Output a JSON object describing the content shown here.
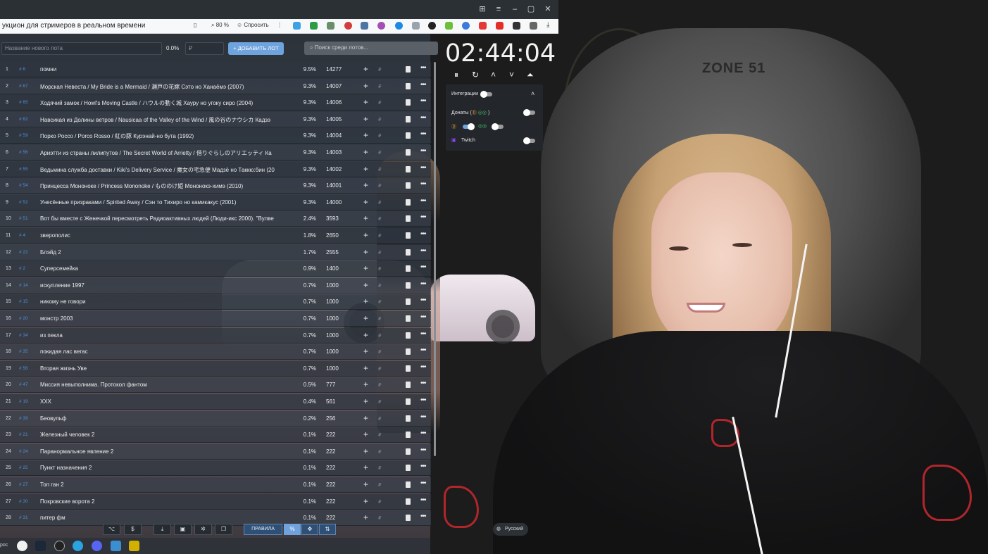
{
  "browser": {
    "page_title": "укцион для стримеров в реальном времени",
    "zoom": "80 %",
    "ask_label": "Спросить",
    "window_controls": [
      "⊞",
      "≡",
      "–",
      "▢",
      "✕"
    ]
  },
  "lot_bar": {
    "name_placeholder": "Название нового лота",
    "percent": "0.0%",
    "price_placeholder": "₽",
    "add_button": "+ ДОБАВИТЬ ЛОТ",
    "search_placeholder": "Поиск среди лотов..."
  },
  "lots": [
    {
      "num": "1",
      "id": "# 6",
      "name": "помни",
      "pct": "9.5%",
      "amount": "14277"
    },
    {
      "num": "2",
      "id": "# 67",
      "name": "Морская Невеста / My Bride is a Mermaid / 瀬戸の花嫁 Сэто но Ханаёмэ (2007)",
      "pct": "9.3%",
      "amount": "14007"
    },
    {
      "num": "3",
      "id": "# 65",
      "name": "Ходячий замок / Howl's Moving Castle / ハウルの動く城 Хауру но угоку сиро (2004)",
      "pct": "9.3%",
      "amount": "14006"
    },
    {
      "num": "4",
      "id": "# 62",
      "name": "Навсикая из Долины ветров / Nausicaa of the Valley of the Wind / 風の谷のナウシカ Кадзэ",
      "pct": "9.3%",
      "amount": "14005"
    },
    {
      "num": "5",
      "id": "# 59",
      "name": "Порко Россо / Porco Rosso / 紅の豚 Курэнай-но бута (1992)",
      "pct": "9.3%",
      "amount": "14004"
    },
    {
      "num": "6",
      "id": "# 56",
      "name": "Ариэтти из страны лилипутов / The Secret World of Arrietty / 借りぐらしのアリエッティ Ка",
      "pct": "9.3%",
      "amount": "14003"
    },
    {
      "num": "7",
      "id": "# 55",
      "name": "Ведьмина служба доставки / Kiki's Delivery Service / 魔女の宅急便 Мадзё но Таккю:бин (20",
      "pct": "9.3%",
      "amount": "14002"
    },
    {
      "num": "8",
      "id": "# 54",
      "name": "Принцесса Мононоке / Princess Mononoke / もののけ姫 Мононокэ-химэ (2010)",
      "pct": "9.3%",
      "amount": "14001"
    },
    {
      "num": "9",
      "id": "# 52",
      "name": "Унесённые призраками / Spirited Away / Сэн то Тихиро но камикакус (2001)",
      "pct": "9.3%",
      "amount": "14000"
    },
    {
      "num": "10",
      "id": "# 51",
      "name": "Вот бы вместе с Женечкой пересмотреть Радиоактивных людей (Люди-икс 2000). \"Вулве",
      "pct": "2.4%",
      "amount": "3593"
    },
    {
      "num": "11",
      "id": "# 4",
      "name": "зверополис",
      "pct": "1.8%",
      "amount": "2650"
    },
    {
      "num": "12",
      "id": "# 22",
      "name": "Блэйд 2",
      "pct": "1.7%",
      "amount": "2555"
    },
    {
      "num": "13",
      "id": "# 2",
      "name": "Суперсемейка",
      "pct": "0.9%",
      "amount": "1400"
    },
    {
      "num": "14",
      "id": "# 14",
      "name": "искупление 1997",
      "pct": "0.7%",
      "amount": "1000"
    },
    {
      "num": "15",
      "id": "# 15",
      "name": "никому не говори",
      "pct": "0.7%",
      "amount": "1000"
    },
    {
      "num": "16",
      "id": "# 20",
      "name": "монстр 2003",
      "pct": "0.7%",
      "amount": "1000"
    },
    {
      "num": "17",
      "id": "# 34",
      "name": "из пекла",
      "pct": "0.7%",
      "amount": "1000"
    },
    {
      "num": "18",
      "id": "# 35",
      "name": "покидая лас вегас",
      "pct": "0.7%",
      "amount": "1000"
    },
    {
      "num": "19",
      "id": "# 56",
      "name": "Вторая жизнь Уве",
      "pct": "0.7%",
      "amount": "1000"
    },
    {
      "num": "20",
      "id": "# 47",
      "name": "Миссия невыполнима. Протокол фантом",
      "pct": "0.5%",
      "amount": "777"
    },
    {
      "num": "21",
      "id": "# 19",
      "name": "XXX",
      "pct": "0.4%",
      "amount": "561"
    },
    {
      "num": "22",
      "id": "# 39",
      "name": "Беовульф",
      "pct": "0.2%",
      "amount": "256"
    },
    {
      "num": "23",
      "id": "# 21",
      "name": "Железный человек 2",
      "pct": "0.1%",
      "amount": "222"
    },
    {
      "num": "24",
      "id": "# 24",
      "name": "Паранормальное явление 2",
      "pct": "0.1%",
      "amount": "222"
    },
    {
      "num": "25",
      "id": "# 25",
      "name": "Пункт назначения 2",
      "pct": "0.1%",
      "amount": "222"
    },
    {
      "num": "26",
      "id": "# 27",
      "name": "Топ ган 2",
      "pct": "0.1%",
      "amount": "222"
    },
    {
      "num": "27",
      "id": "# 30",
      "name": "Покровские ворота 2",
      "pct": "0.1%",
      "amount": "222"
    },
    {
      "num": "28",
      "id": "# 31",
      "name": "питер фм",
      "pct": "0.1%",
      "amount": "222"
    }
  ],
  "row_actions": {
    "plus": "+",
    "currency": "₽",
    "more": "•••"
  },
  "toolbar": {
    "github": "⌥",
    "dollar": "$",
    "download": "⤓",
    "save": "▣",
    "bug": "✲",
    "copy": "❐",
    "rules": "ПРАВИЛА",
    "percent": "%",
    "move": "✥",
    "sort": "⇅"
  },
  "timer": {
    "time": "02:44:04",
    "controls": [
      "⏸",
      "↻",
      "˄",
      "˅",
      "⏶"
    ]
  },
  "integrations": {
    "title": "Интеграции",
    "collapse": "˄",
    "donations_label": "Донаты (",
    "donations_close": ")",
    "twitch_label": "Twitch",
    "toggles": {
      "integrations": false,
      "donations": false,
      "donatepay": true,
      "second": false,
      "twitch": false
    }
  },
  "language": {
    "label": "Русский"
  },
  "cam": {
    "chair_brand": "ZONE 51"
  },
  "taskbar": {
    "left_text": "рос"
  },
  "colors": {
    "accent": "#6ea3dd",
    "id": "#4e8fd6"
  }
}
